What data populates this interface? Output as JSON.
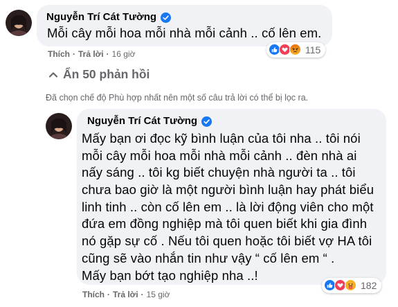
{
  "colors": {
    "bubble": "#f0f2f5",
    "meta": "#65676b",
    "verified": "#1877f2",
    "like": "#1877f2",
    "love": "#f33e58",
    "angry": "#e9710f",
    "care": "#f7b125"
  },
  "comment_1": {
    "author": "Nguyễn Trí Cát Tường",
    "verified_icon": "verified-badge-icon",
    "text": "Mỗi cây mỗi hoa mỗi nhà mỗi cảnh .. cố lên em.",
    "actions": {
      "like": "Thích",
      "separator": "·",
      "reply": "Trả lời",
      "time": "16 giờ"
    },
    "reactions": {
      "icons": [
        "like-icon",
        "love-icon",
        "angry-icon"
      ],
      "count": "115"
    }
  },
  "show_replies": {
    "icon": "reply-arrow-icon",
    "label": "Ẩn 50 phản hồi"
  },
  "filter_note": "Đã chọn chế độ Phù hợp nhất nên một số câu trả lời có thể bị lọc ra.",
  "comment_2": {
    "author": "Nguyễn Trí Cát Tường",
    "verified_icon": "verified-badge-icon",
    "lines": [
      "Mấy bạn ơi đọc kỹ bình luận của tôi nha .. tôi nói",
      "mỗi cây mỗi hoa mỗi nhà mỗi cảnh .. đèn nhà ai",
      "nấy sáng .. tôi kg biết chuyện nhà người ta .. tôi",
      "chưa bao giờ là một người bình luận hay phát biểu",
      "linh tinh .. còn cố lên em .. là lời động viên cho một",
      "đứa em đồng nghiệp mà tôi quen biết khi gia đình",
      "nó gặp sự cố . Nếu tôi quen hoặc tôi biết vợ HA tôi",
      "cũng sẽ vào nhắn tin như vậy “ cố lên em “ .",
      "Mấy bạn bớt tạo nghiệp nha ..!"
    ],
    "actions": {
      "like": "Thích",
      "separator": "·",
      "reply": "Trả lời",
      "time": "15 giờ"
    },
    "reactions": {
      "icons": [
        "like-icon",
        "love-icon",
        "care-icon"
      ],
      "count": "182"
    }
  }
}
